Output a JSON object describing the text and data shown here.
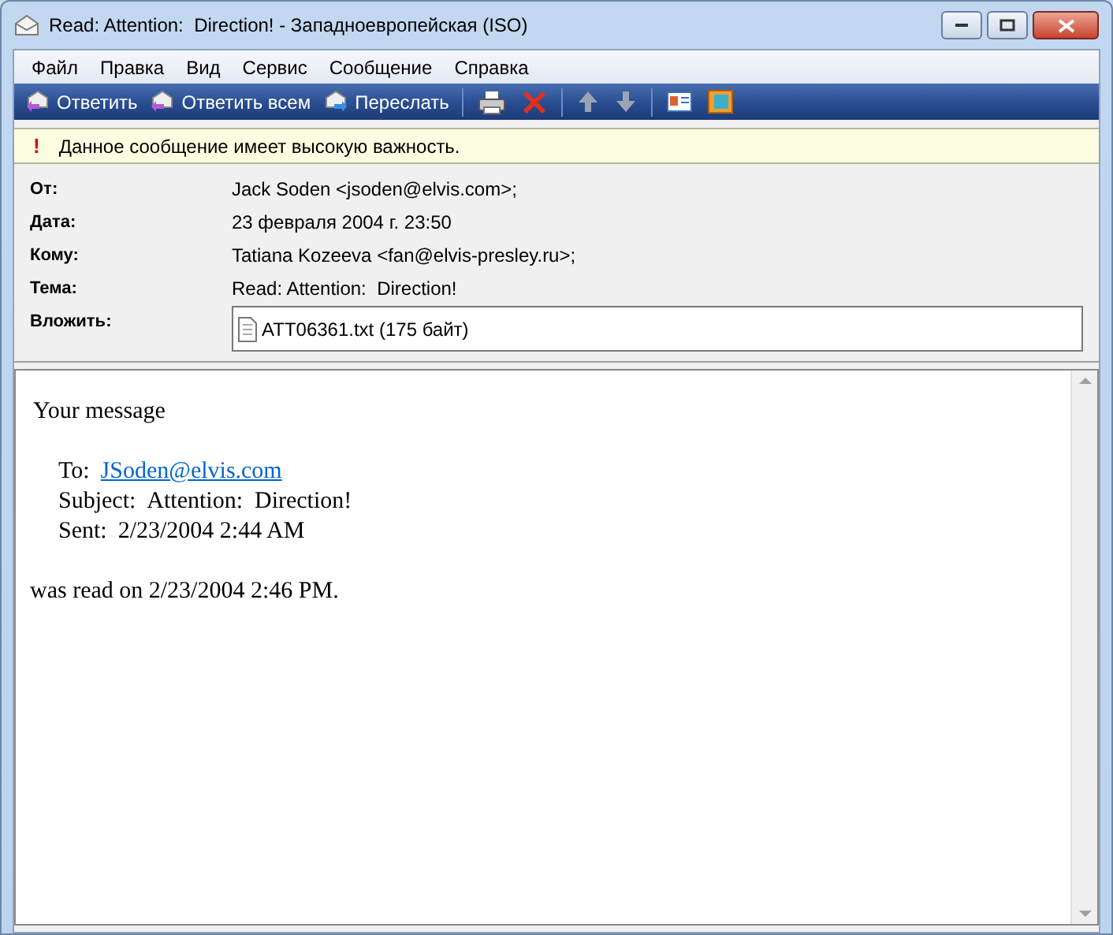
{
  "window": {
    "title": "Read: Attention:  Direction! - Западноевропейская (ISO)"
  },
  "menu": [
    "Файл",
    "Правка",
    "Вид",
    "Сервис",
    "Сообщение",
    "Справка"
  ],
  "toolbar": {
    "buttons": [
      "Ответить",
      "Ответить всем",
      "Переслать"
    ]
  },
  "importance_bar": {
    "mark": "!",
    "text": "Данное сообщение имеет высокую важность."
  },
  "headers": [
    {
      "kind": "text",
      "label": "От:",
      "value": "Jack Soden <jsoden@elvis.com>;"
    },
    {
      "kind": "text",
      "label": "Дата:",
      "value": "23 февраля 2004 г. 23:50"
    },
    {
      "kind": "text",
      "label": "Кому:",
      "value": "Tatiana Kozeeva <fan@elvis-presley.ru>;"
    },
    {
      "kind": "text",
      "label": "Тема:",
      "value": "Read: Attention:  Direction!"
    },
    {
      "kind": "attachment",
      "label": "Вложить:",
      "value": "ATT06361.txt (175 байт)"
    }
  ],
  "body": {
    "intro": "Your message",
    "fields": [
      {
        "label": "To:",
        "value": "JSoden@elvis.com",
        "link": true
      },
      {
        "label": "Subject:",
        "value": "Attention:  Direction!",
        "link": false
      },
      {
        "label": "Sent:",
        "value": "2/23/2004 2:44 AM",
        "link": false
      }
    ],
    "outro": "was read on 2/23/2004 2:46 PM."
  }
}
